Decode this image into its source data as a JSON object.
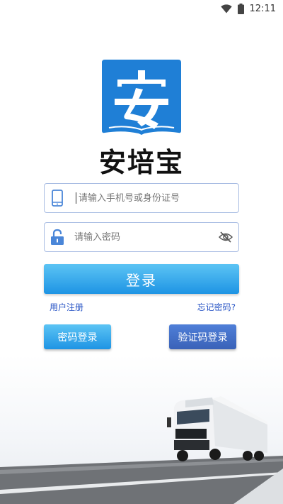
{
  "status_bar": {
    "time": "12:11"
  },
  "app": {
    "logo_char": "安",
    "name": "安培宝"
  },
  "login": {
    "phone_placeholder": "请输入手机号或身份证号",
    "password_placeholder": "请输入密码",
    "submit_label": "登录",
    "register_link": "用户注册",
    "forgot_link": "忘记密码?",
    "password_login_label": "密码登录",
    "code_login_label": "验证码登录"
  },
  "colors": {
    "primary_blue": "#1e94e4",
    "secondary_blue": "#3a62b8",
    "logo_blue": "#1f7fd6",
    "link_blue": "#2a56c6"
  },
  "icons": [
    "wifi-icon",
    "battery-icon",
    "phone-icon",
    "lock-icon",
    "eye-off-icon"
  ]
}
